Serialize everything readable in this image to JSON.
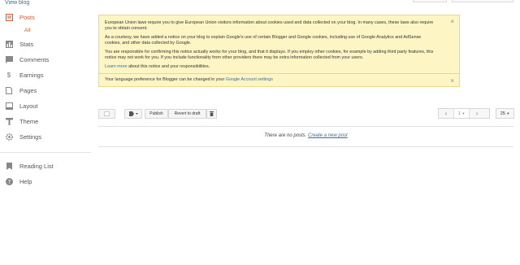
{
  "sidebar": {
    "view_blog": "View blog",
    "posts": "Posts",
    "posts_sub": "All",
    "stats": "Stats",
    "comments": "Comments",
    "earnings": "Earnings",
    "pages": "Pages",
    "layout": "Layout",
    "theme": "Theme",
    "settings": "Settings",
    "reading_list": "Reading List",
    "help": "Help",
    "active_color": "#e8501f"
  },
  "notice": {
    "p1": "European Union laws require you to give European Union visitors information about cookies used and data collected on your blog. In many cases, these laws also require you to obtain consent.",
    "p2": "As a courtesy, we have added a notice on your blog to explain Google's use of certain Blogger and Google cookies, including use of Google Analytics and AdSense cookies, and other data collected by Google.",
    "p3": "You are responsible for confirming this notice actually works for your blog, and that it displays. If you employ other cookies, for example by adding third party features, this notice may not work for you. If you include functionality from other providers there may be extra information collected from your users.",
    "learn_more": "Learn more",
    "learn_more_rest": " about this notice and your responsibilities.",
    "lang_text": "Your language preference for Blogger can be changed in your ",
    "lang_link": "Google Account settings",
    "close": "×"
  },
  "toolbar": {
    "publish": "Publish",
    "revert": "Revert to draft",
    "page_value": "1",
    "per_page": "25"
  },
  "empty": {
    "text": "There are no posts. ",
    "link": "Create a new post"
  }
}
